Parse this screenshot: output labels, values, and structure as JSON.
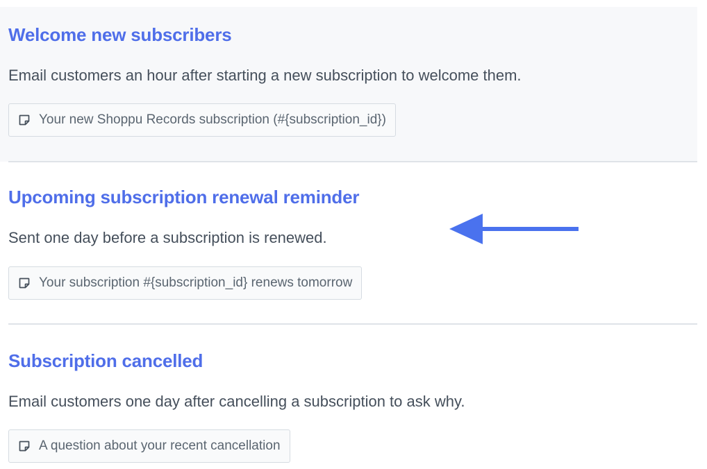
{
  "notifications": [
    {
      "title": "Welcome new subscribers",
      "description": "Email customers an hour after starting a new subscription to welcome them.",
      "subject": "Your new Shoppu Records subscription (#{subscription_id})"
    },
    {
      "title": "Upcoming subscription renewal reminder",
      "description": "Sent one day before a subscription is renewed.",
      "subject": "Your subscription #{subscription_id} renews tomorrow"
    },
    {
      "title": "Subscription cancelled",
      "description": "Email customers one day after cancelling a subscription to ask why.",
      "subject": "A question about your recent cancellation"
    }
  ],
  "icons": {
    "subject": "note-icon",
    "pointer": "arrow-left-icon"
  },
  "colors": {
    "accent": "#4f6ee9",
    "arrow": "#4a72ee",
    "text": "#454f5b",
    "highlight_bg": "#f7f8fa",
    "divider": "#dfe3e8"
  }
}
